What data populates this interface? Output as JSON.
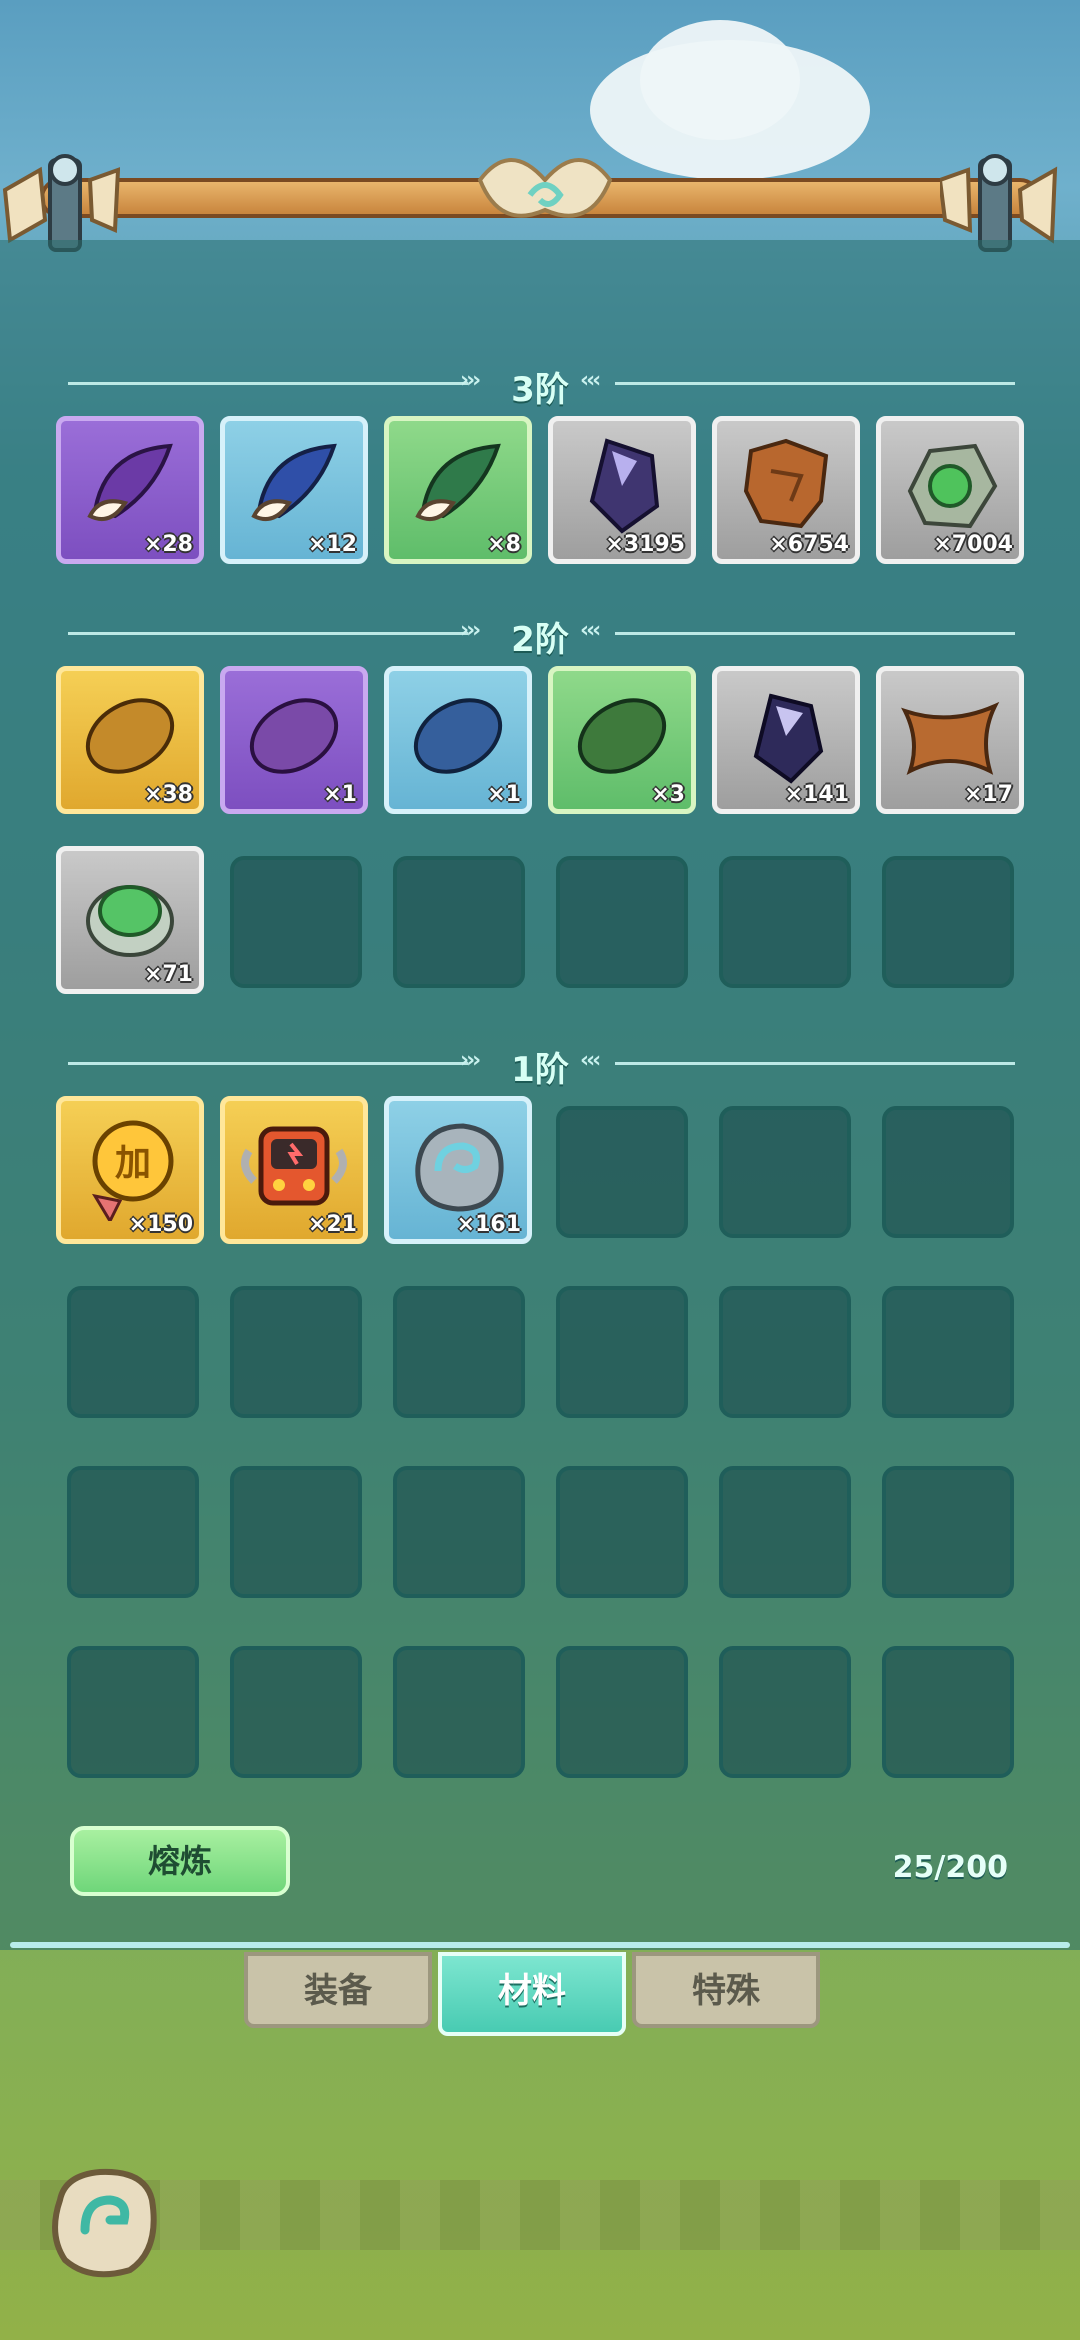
{
  "tiers": {
    "t3": {
      "label": "3阶"
    },
    "t2": {
      "label": "2阶"
    },
    "t1": {
      "label": "1阶"
    }
  },
  "items": {
    "t3": [
      {
        "icon": "purple-wing-icon",
        "qty": "×28",
        "rarity": "purple"
      },
      {
        "icon": "blue-wing-icon",
        "qty": "×12",
        "rarity": "blue"
      },
      {
        "icon": "green-wing-icon",
        "qty": "×8",
        "rarity": "green"
      },
      {
        "icon": "dark-crystal-icon",
        "qty": "×3195",
        "rarity": "gray"
      },
      {
        "icon": "brown-hide-icon",
        "qty": "×6754",
        "rarity": "gray"
      },
      {
        "icon": "green-ore-icon",
        "qty": "×7004",
        "rarity": "gray"
      }
    ],
    "t2": [
      {
        "icon": "gold-fur-icon",
        "qty": "×38",
        "rarity": "gold"
      },
      {
        "icon": "purple-fur-icon",
        "qty": "×1",
        "rarity": "purple"
      },
      {
        "icon": "blue-fur-icon",
        "qty": "×1",
        "rarity": "blue"
      },
      {
        "icon": "green-fur-icon",
        "qty": "×3",
        "rarity": "green"
      },
      {
        "icon": "crystal-icon",
        "qty": "×141",
        "rarity": "gray"
      },
      {
        "icon": "leather-icon",
        "qty": "×17",
        "rarity": "gray"
      },
      {
        "icon": "green-stone-icon",
        "qty": "×71",
        "rarity": "gray"
      }
    ],
    "t1": [
      {
        "icon": "gold-coin-medal-icon",
        "qty": "×150",
        "rarity": "gold"
      },
      {
        "icon": "device-chip-icon",
        "qty": "×21",
        "rarity": "gold"
      },
      {
        "icon": "rune-stone-icon",
        "qty": "×161",
        "rarity": "blue"
      }
    ]
  },
  "coin_text": "加",
  "smelt_label": "熔炼",
  "capacity": "25/200",
  "tabs": [
    {
      "label": "装备",
      "active": false
    },
    {
      "label": "材料",
      "active": true
    },
    {
      "label": "特殊",
      "active": false
    }
  ],
  "colors": {
    "accent": "#48cbb2",
    "panel": "#2e6f6c"
  }
}
